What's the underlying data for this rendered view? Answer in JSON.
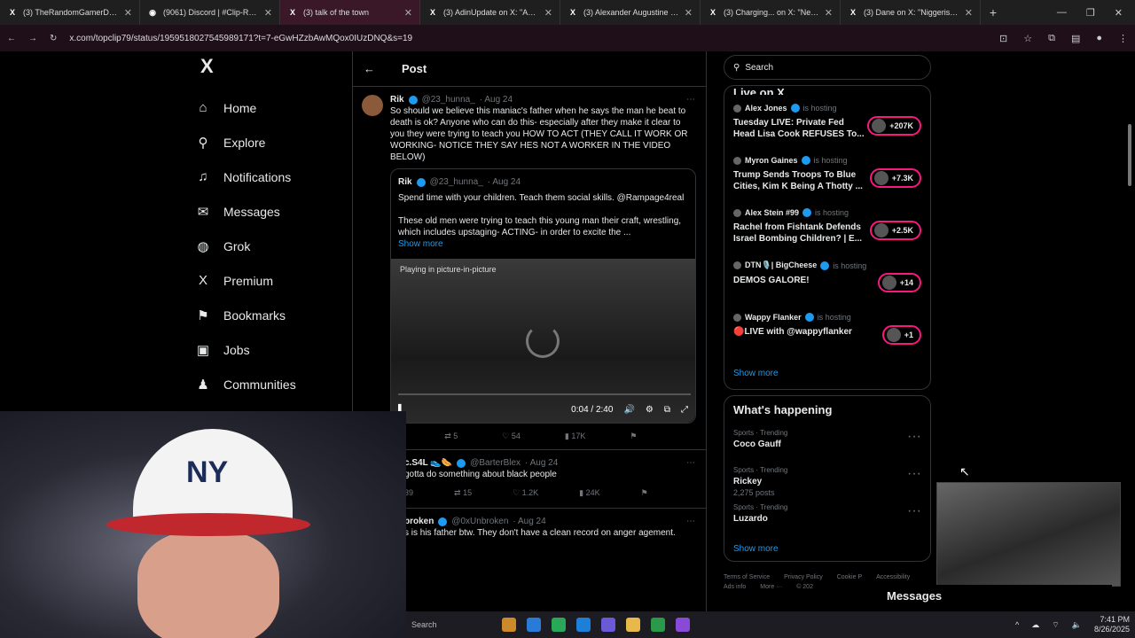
{
  "browser": {
    "tabs": [
      {
        "title": "(3) TheRandomGamerDude on",
        "icon": "x-icon",
        "active": false
      },
      {
        "title": "(9061) Discord | #Clip-Reaction",
        "icon": "discord-icon",
        "active": false
      },
      {
        "title": "(3) talk of the town",
        "icon": "x-icon",
        "active": true
      },
      {
        "title": "(3) AdinUpdate on X: \"Adin Ro",
        "icon": "x-icon",
        "active": false
      },
      {
        "title": "(3) Alexander Augustine on X: \"",
        "icon": "x-icon",
        "active": false
      },
      {
        "title": "(3) Charging... on X: \"Netanyah",
        "icon": "x-icon",
        "active": false
      },
      {
        "title": "(3) Dane on X: \"Niggerism ~ Th",
        "icon": "x-icon",
        "active": false
      }
    ],
    "url": "x.com/topclip79/status/1959518027545989171?t=7-eGwHZzbAwMQox0IUzDNQ&s=19"
  },
  "nav": {
    "logo": "X",
    "items": [
      {
        "label": "Home",
        "icon": "home-icon",
        "glyph": "⌂"
      },
      {
        "label": "Explore",
        "icon": "search-icon",
        "glyph": "⚲"
      },
      {
        "label": "Notifications",
        "icon": "bell-icon",
        "glyph": "♫"
      },
      {
        "label": "Messages",
        "icon": "mail-icon",
        "glyph": "✉"
      },
      {
        "label": "Grok",
        "icon": "grok-icon",
        "glyph": "◍"
      },
      {
        "label": "Premium",
        "icon": "x-icon",
        "glyph": "X"
      },
      {
        "label": "Bookmarks",
        "icon": "bookmark-icon",
        "glyph": "⚑"
      },
      {
        "label": "Jobs",
        "icon": "briefcase-icon",
        "glyph": "▣"
      },
      {
        "label": "Communities",
        "icon": "people-icon",
        "glyph": "♟"
      }
    ]
  },
  "main": {
    "header": "Post",
    "post": {
      "name": "Rik",
      "handle": "@23_hunna_",
      "date": "· Aug 24",
      "text": "So should we believe this maniac's father when he says the man he beat to death is ok? Anyone who can do this- especially after they make it clear to you they were trying to teach you HOW TO ACT (THEY CALL IT WORK OR WORKING- NOTICE THEY SAY HES NOT A WORKER IN THE VIDEO BELOW)",
      "quote": {
        "name": "Rik",
        "handle": "@23_hunna_",
        "date": "· Aug 24",
        "text1": "Spend time with your children. Teach them social skills. @Rampage4real",
        "text2": "These old men were trying to teach this young man their craft, wrestling, which includes upstaging- ACTING- in order to excite the ...",
        "show_more": "Show more",
        "pip_label": "Playing in picture-in-picture",
        "time": "0:04 / 2:40"
      },
      "stats": {
        "reposts": "5",
        "likes": "54",
        "views": "17K"
      }
    },
    "replies": [
      {
        "name": "c.S4L 👟🌭",
        "handle": "@BarterBlex",
        "date": "· Aug 24",
        "text": "gotta do something about black people",
        "replies": "39",
        "reposts": "15",
        "likes": "1.2K",
        "views": "24K"
      },
      {
        "name": "broken",
        "handle": "@0xUnbroken",
        "date": "· Aug 24",
        "text": "s is his father btw. They don't have a clean record on anger agement."
      }
    ]
  },
  "right": {
    "search_placeholder": "Search",
    "live_header": "Live on X",
    "live": [
      {
        "host": "Alex Jones",
        "status": "is hosting",
        "title": "Tuesday LIVE: Private Fed Head Lisa Cook REFUSES To...",
        "count": "+207K"
      },
      {
        "host": "Myron Gaines",
        "status": "is hosting",
        "title": "Trump Sends Troops To Blue Cities, Kim K Being A Thotty ...",
        "count": "+7.3K"
      },
      {
        "host": "Alex Stein #99",
        "status": "is hosting",
        "title": "Rachel from Fishtank Defends Israel Bombing Children? | E...",
        "count": "+2.5K"
      },
      {
        "host": "DTN🎙️| BigCheese",
        "status": "is hosting",
        "title": "DEMOS GALORE!",
        "count": "+14"
      },
      {
        "host": "Wappy Flanker",
        "status": "is hosting",
        "title": "🔴LIVE with @wappyflanker",
        "count": "+1"
      }
    ],
    "live_show_more": "Show more",
    "happening_header": "What's happening",
    "trends": [
      {
        "category": "Sports · Trending",
        "name": "Coco Gauff",
        "posts": ""
      },
      {
        "category": "Sports · Trending",
        "name": "Rickey",
        "posts": "2,275 posts"
      },
      {
        "category": "Sports · Trending",
        "name": "Luzardo",
        "posts": ""
      }
    ],
    "trends_show_more": "Show more",
    "footer": [
      "Terms of Service",
      "Privacy Policy",
      "Cookie P",
      "Accessibility",
      "Ads info",
      "More ···",
      "© 202"
    ]
  },
  "messages_label": "Messages",
  "taskbar": {
    "search": "Search",
    "time": "7:41 PM",
    "date": "8/26/2025"
  }
}
